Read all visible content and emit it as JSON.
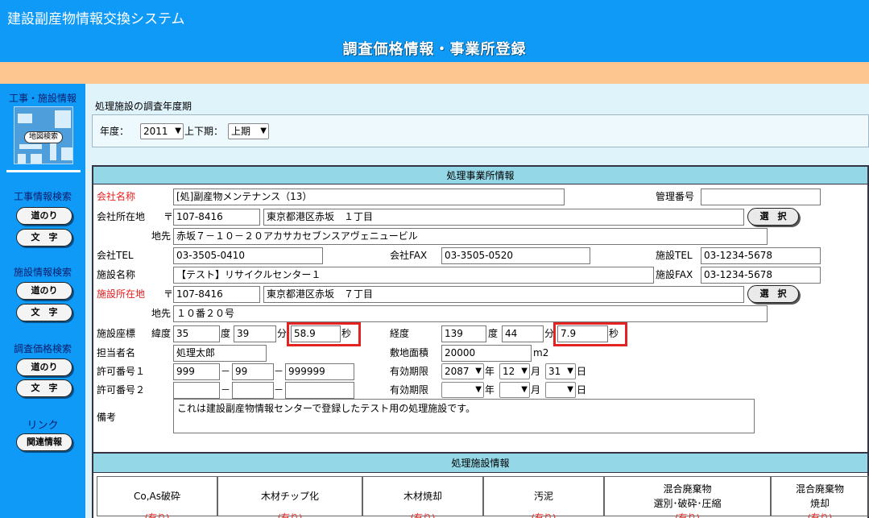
{
  "header": {
    "app_title": "建設副産物情報交換システム",
    "page_title": "調査価格情報・事業所登録"
  },
  "sidebar": {
    "construction_label": "工事・施設情報",
    "map_search": "地図検索",
    "construction_search": "工事情報検索",
    "facility_search": "施設情報検索",
    "price_search": "調査価格検索",
    "route_btn": "道のり",
    "text_btn": "文　字",
    "link_label": "リンク",
    "related_btn": "関連情報"
  },
  "year_section": {
    "caption": "処理施設の調査年度期",
    "year_label": "年度：",
    "year_value": "2011",
    "half_label": "上下期：",
    "half_value": "上期"
  },
  "office": {
    "header": "処理事業所情報",
    "company_name_label": "会社名称",
    "company_name": "[処]副産物メンテナンス（13）",
    "mgmt_no_label": "管理番号",
    "mgmt_no": "",
    "company_addr_label": "会社所在地",
    "postal_mark": "〒",
    "company_zip": "107-8416",
    "company_addr": "東京都港区赤坂　１丁目",
    "select_btn": "選　択",
    "chisaki_label": "地先",
    "company_chisaki": "赤坂７－１０－２０アカサカセブンスアヴェニュービル",
    "company_tel_label": "会社TEL",
    "company_tel": "03-3505-0410",
    "company_fax_label": "会社FAX",
    "company_fax": "03-3505-0520",
    "facility_tel_label": "施設TEL",
    "facility_tel": "03-1234-5678",
    "facility_name_label": "施設名称",
    "facility_name": "【テスト】リサイクルセンター１",
    "facility_fax_label": "施設FAX",
    "facility_fax": "03-1234-5678",
    "facility_addr_label": "施設所在地",
    "facility_zip": "107-8416",
    "facility_addr": "東京都港区赤坂　７丁目",
    "facility_chisaki": "１０番２０号",
    "coord_label": "施設座標",
    "lat_label": "緯度",
    "lat_deg": "35",
    "deg": "度",
    "lat_min": "39",
    "min": "分",
    "lat_sec": "58.9",
    "sec": "秒",
    "lng_label": "経度",
    "lng_deg": "139",
    "lng_min": "44",
    "lng_sec": "7.9",
    "person_label": "担当者名",
    "person": "処理太郎",
    "area_label": "敷地面積",
    "area": "20000",
    "area_unit": "m2",
    "permit1_label": "許可番号１",
    "permit1_a": "999",
    "permit1_b": "99",
    "permit1_c": "999999",
    "dash": "－",
    "valid_label": "有効期限",
    "valid_year": "2087",
    "year_unit": "年",
    "valid_month": "12",
    "month_unit": "月",
    "valid_day": "31",
    "day_unit": "日",
    "permit2_label": "許可番号２",
    "permit2_a": "",
    "permit2_b": "",
    "permit2_c": "",
    "valid2_year": "",
    "valid2_month": "",
    "valid2_day": "",
    "remarks_label": "備考",
    "remarks": "これは建設副産物情報センターで登録したテスト用の処理施設です。"
  },
  "facility_info": {
    "header": "処理施設情報",
    "columns": [
      {
        "line1": "Co,As破砕",
        "line2": ""
      },
      {
        "line1": "木材チップ化",
        "line2": ""
      },
      {
        "line1": "木材焼却",
        "line2": ""
      },
      {
        "line1": "汚泥",
        "line2": ""
      },
      {
        "line1": "混合廃棄物",
        "line2": "選別･破砕･圧縮"
      },
      {
        "line1": "混合廃棄物",
        "line2": "焼却"
      }
    ],
    "availability": "(有り)"
  }
}
